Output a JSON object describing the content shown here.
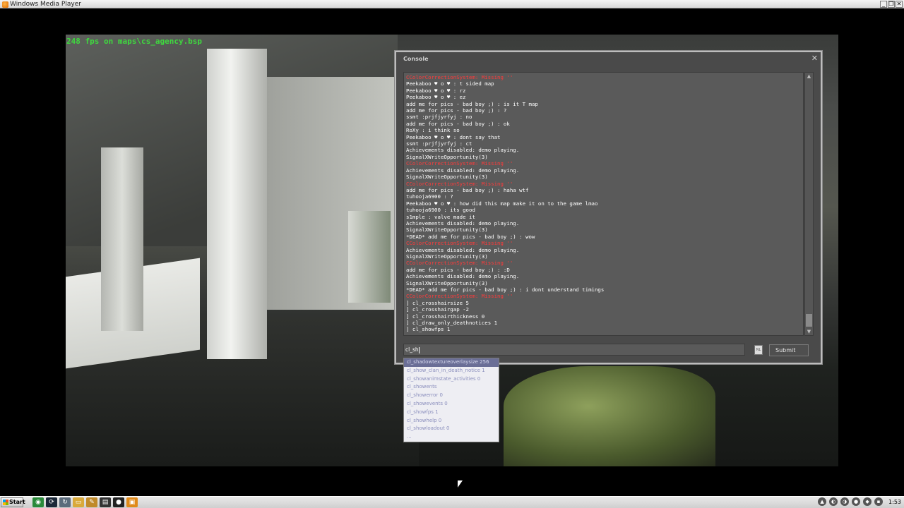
{
  "window": {
    "title": "Windows Media Player",
    "controls": [
      "_",
      "❐",
      "✕"
    ]
  },
  "video": {
    "fps_overlay": "248 fps on maps\\cs_agency.bsp"
  },
  "console": {
    "title": "Console",
    "close": "✕",
    "log": [
      {
        "text": "CColorCorrectionSystem: Missing ''",
        "err": true
      },
      {
        "text": "Peekaboo ♥ ο ♥ : t sided map",
        "err": false
      },
      {
        "text": "Peekaboo ♥ ο ♥ : rz",
        "err": false
      },
      {
        "text": "Peekaboo ♥ ο ♥ : ez",
        "err": false
      },
      {
        "text": "add me for pics - bad boy ;) : is it T map",
        "err": false
      },
      {
        "text": "add me for pics - bad boy ;) : ?",
        "err": false
      },
      {
        "text": "ssmt :prjfjyrfyj : no",
        "err": false
      },
      {
        "text": "add me for pics - bad boy ;) : ok",
        "err": false
      },
      {
        "text": "RoXy : i think so",
        "err": false
      },
      {
        "text": "Peekaboo ♥ ο ♥ : dont say that",
        "err": false
      },
      {
        "text": "ssmt :prjfjyrfyj : ct",
        "err": false
      },
      {
        "text": "Achievements disabled: demo playing.",
        "err": false
      },
      {
        "text": "SignalXWriteOpportunity(3)",
        "err": false
      },
      {
        "text": "CColorCorrectionSystem: Missing ''",
        "err": true
      },
      {
        "text": "Achievements disabled: demo playing.",
        "err": false
      },
      {
        "text": "SignalXWriteOpportunity(3)",
        "err": false
      },
      {
        "text": "CColorCorrectionSystem: Missing ''",
        "err": true
      },
      {
        "text": "add me for pics - bad boy ;) : haha wtf",
        "err": false
      },
      {
        "text": "tuhooja6900 : ?",
        "err": false
      },
      {
        "text": "Peekaboo ♥ ο ♥ : how did this map make it on to the game lmao",
        "err": false
      },
      {
        "text": "tuhooja6900 : its good",
        "err": false
      },
      {
        "text": "s1mple : valve made it",
        "err": false
      },
      {
        "text": "Achievements disabled: demo playing.",
        "err": false
      },
      {
        "text": "SignalXWriteOpportunity(3)",
        "err": false
      },
      {
        "text": "*DEAD* add me for pics - bad boy ;) : wow",
        "err": false
      },
      {
        "text": "CColorCorrectionSystem: Missing ''",
        "err": true
      },
      {
        "text": "Achievements disabled: demo playing.",
        "err": false
      },
      {
        "text": "SignalXWriteOpportunity(3)",
        "err": false
      },
      {
        "text": "CColorCorrectionSystem: Missing ''",
        "err": true
      },
      {
        "text": "add me for pics - bad boy ;) : :D",
        "err": false
      },
      {
        "text": "Achievements disabled: demo playing.",
        "err": false
      },
      {
        "text": "SignalXWriteOpportunity(3)",
        "err": false
      },
      {
        "text": "*DEAD* add me for pics - bad boy ;) : i dont understand timings",
        "err": false
      },
      {
        "text": "CColorCorrectionSystem: Missing ''",
        "err": true
      },
      {
        "text": "] cl_crosshairsize 5",
        "err": false
      },
      {
        "text": "] cl_crosshairgap -2",
        "err": false
      },
      {
        "text": "] cl_crosshairthickness 0",
        "err": false
      },
      {
        "text": "] cl_draw_only_deathnotices 1",
        "err": false
      },
      {
        "text": "] cl_showfps 1",
        "err": false
      }
    ],
    "input_value": "cl_sh",
    "nl_label": "NL",
    "submit_label": "Submit"
  },
  "autocomplete": {
    "items": [
      "cl_shadowtextureoverlaysize 256",
      "cl_show_clan_in_death_notice 1",
      "cl_showanimstate_activities 0",
      "cl_showents",
      "cl_showerror 0",
      "cl_showevents 0",
      "cl_showfps 1",
      "cl_showhelp 0",
      "cl_showloadout 0",
      "..."
    ],
    "selected_index": 0
  },
  "taskbar": {
    "start_label": "Start",
    "quick_launch": [
      {
        "icon": "chrome-icon",
        "color": "#2a8a3a",
        "glyph": "◉"
      },
      {
        "icon": "steam-icon",
        "color": "#1b2838",
        "glyph": "⟳"
      },
      {
        "icon": "refresh-icon",
        "color": "#5b6b7b",
        "glyph": "↻"
      },
      {
        "icon": "folder-icon",
        "color": "#d9a93a",
        "glyph": "▭"
      },
      {
        "icon": "pencil-icon",
        "color": "#c08a2a",
        "glyph": "✎"
      },
      {
        "icon": "terminal-icon",
        "color": "#333333",
        "glyph": "▤"
      },
      {
        "icon": "csgo-icon",
        "color": "#222222",
        "glyph": "●"
      },
      {
        "icon": "media-player-icon",
        "color": "#e08a1a",
        "glyph": "▣"
      }
    ],
    "tray": [
      {
        "icon": "expand-tray-icon",
        "glyph": "▲"
      },
      {
        "icon": "network-icon",
        "glyph": "◐"
      },
      {
        "icon": "volume-icon",
        "glyph": "◑"
      },
      {
        "icon": "steam-tray-icon",
        "glyph": "●"
      },
      {
        "icon": "security-icon",
        "glyph": "◆"
      },
      {
        "icon": "display-icon",
        "glyph": "▪"
      }
    ],
    "clock": "1:53"
  }
}
